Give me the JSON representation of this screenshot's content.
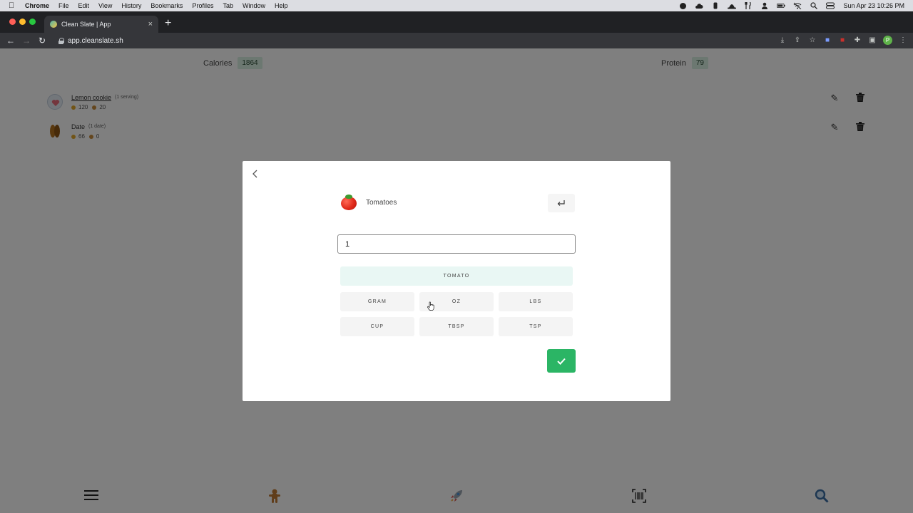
{
  "menubar": {
    "app": "Chrome",
    "items": [
      "File",
      "Edit",
      "View",
      "History",
      "Bookmarks",
      "Profiles",
      "Tab",
      "Window",
      "Help"
    ],
    "clock": "Sun Apr 23  10:26 PM"
  },
  "browser": {
    "tab_title": "Clean Slate | App",
    "url": "app.cleanslate.sh",
    "profile_initial": "P"
  },
  "stats": {
    "calories_label": "Calories",
    "calories_value": "1864",
    "protein_label": "Protein",
    "protein_value": "79"
  },
  "entries": [
    {
      "name": "Lemon cookie",
      "serving": "(1 serving)",
      "calories": "120",
      "protein": "20"
    },
    {
      "name": "Date",
      "serving": "(1 date)",
      "calories": "66",
      "protein": "0"
    }
  ],
  "modal": {
    "food_name": "Tomatoes",
    "quantity": "1",
    "units": {
      "primary": "TOMATO",
      "gram": "GRAM",
      "oz": "OZ",
      "lbs": "LBS",
      "cup": "CUP",
      "tbsp": "TBSP",
      "tsp": "TSP"
    },
    "selected_unit": "TOMATO"
  },
  "colors": {
    "accent_green": "#2bb565",
    "stat_badge": "#d9f1e2",
    "selected_unit_bg": "#e9f7f4"
  },
  "icons": {
    "enter": "return-icon",
    "confirm": "check-icon",
    "back": "chevron-left-icon"
  }
}
